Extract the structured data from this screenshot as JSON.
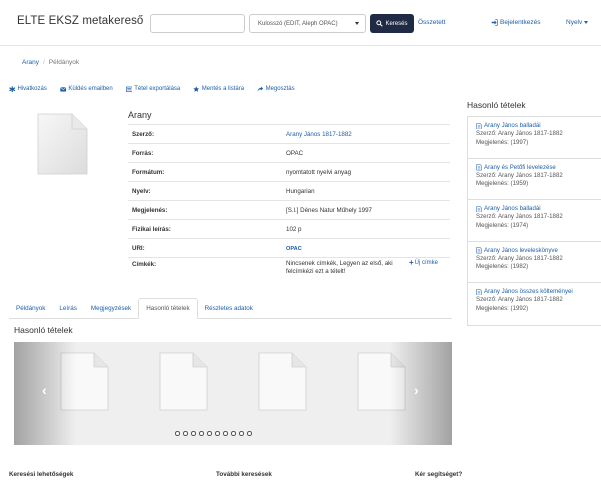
{
  "navbar": {
    "brand": "ELTE EKSZ metakereső",
    "search_placeholder": "",
    "search_type": "Kulosszó (EDIT, Aleph OPAC)",
    "search_button": "Keresés",
    "advanced": "Összetett",
    "login": "Bejelentkezés",
    "language": "Nyelv"
  },
  "breadcrumb": {
    "items": [
      "Arany",
      "Példányok"
    ]
  },
  "toolbar": {
    "cite": "Hivatkozás",
    "email": "Küldés emailben",
    "export": "Tétel exportálása",
    "save": "Mentés a listára",
    "share": "Megosztás"
  },
  "record": {
    "title": "Arany",
    "rows": [
      {
        "label": "Szerző:",
        "value": "Arany János 1817-1882"
      },
      {
        "label": "Forrás:",
        "value": "OPAC"
      },
      {
        "label": "Formátum:",
        "value": "nyomtatott nyelvi anyag"
      },
      {
        "label": "Nyelv:",
        "value": "Hungarian"
      },
      {
        "label": "Megjelenés:",
        "value": "[S.l.] Dénes Natur Műhely 1997"
      },
      {
        "label": "Fizikai leírás:",
        "value": "102 p"
      },
      {
        "label": "URI:",
        "value": "OPAC"
      },
      {
        "label": "Címkék:",
        "value": "Nincsenek címkék, Legyen az első, aki felcímkézi ezt a tételt!"
      }
    ],
    "add_tag": "Új címke"
  },
  "tabs": {
    "items": [
      {
        "label": "Példányok",
        "active": false
      },
      {
        "label": "Leírás",
        "active": false
      },
      {
        "label": "Megjegyzések",
        "active": false
      },
      {
        "label": "Hasonló tételek",
        "active": true
      },
      {
        "label": "Részletes adatok",
        "active": false
      }
    ]
  },
  "similar_section": {
    "heading": "Hasonló tételek",
    "slide_count": 4,
    "dot_count": 10
  },
  "sidebar": {
    "heading": "Hasonló tételek",
    "items": [
      {
        "title": "Arany János balladái",
        "author": "Szerző: Arany János 1817-1882",
        "published": "Megjelenés: (1997)"
      },
      {
        "title": "Arany és Petőfi levelezése",
        "author": "Szerző: Arany János 1817-1882",
        "published": "Megjelenés: (1959)"
      },
      {
        "title": "Arany János balladái",
        "author": "Szerző: Arany János 1817-1882",
        "published": "Megjelenés: (1974)"
      },
      {
        "title": "Arany János leveleskönyve",
        "author": "Szerző: Arany János 1817-1882",
        "published": "Megjelenés: (1982)"
      },
      {
        "title": "Arany János összes költeményei",
        "author": "Szerző: Arany János 1817-1882",
        "published": "Megjelenés: (1992)"
      }
    ]
  },
  "footer": {
    "col1": "Keresési lehetőségek",
    "col2": "További keresések",
    "col3": "Kér segítséget?"
  },
  "colors": {
    "link": "#1f5fa6",
    "search_button_bg": "#1f2a44"
  }
}
